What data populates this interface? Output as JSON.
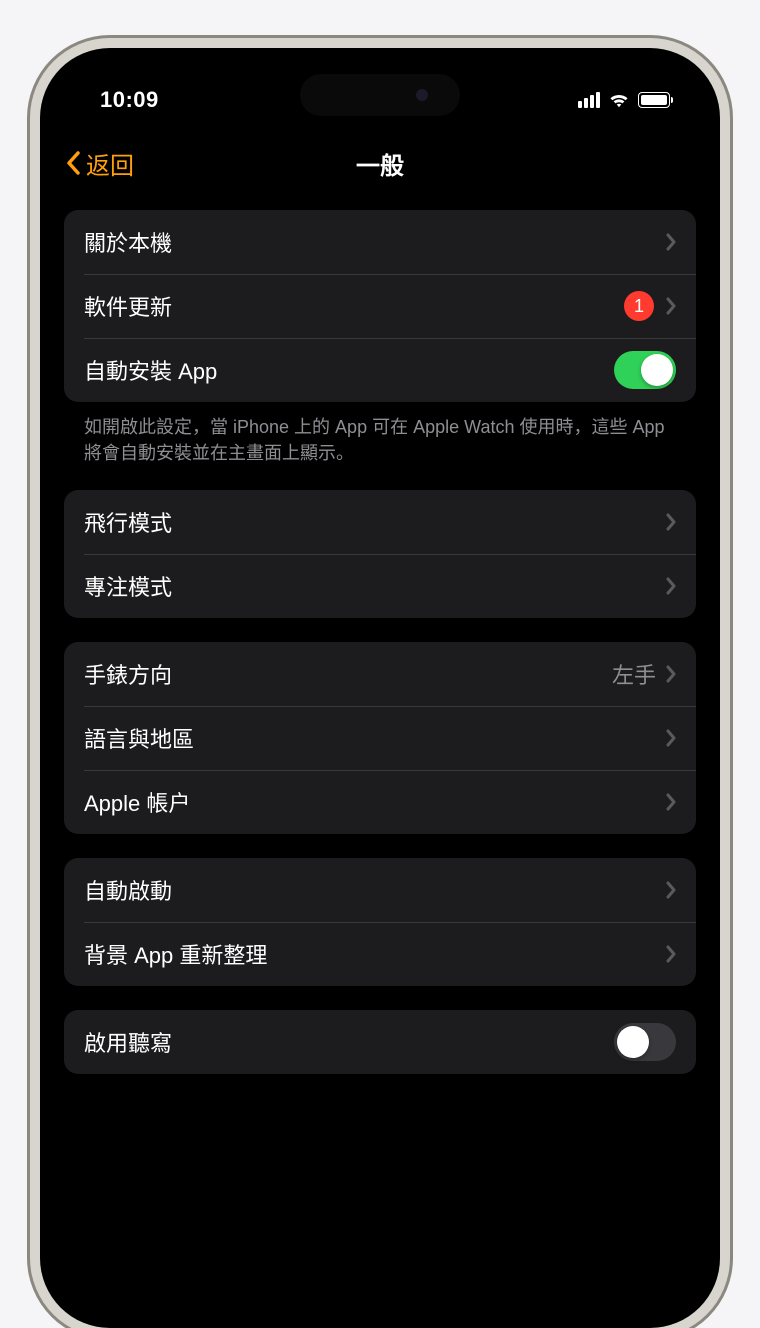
{
  "status": {
    "time": "10:09"
  },
  "nav": {
    "back": "返回",
    "title": "一般"
  },
  "group1": {
    "about": "關於本機",
    "softwareUpdate": "軟件更新",
    "badgeCount": "1",
    "autoInstall": "自動安裝 App",
    "footer": "如開啟此設定，當 iPhone 上的 App 可在 Apple Watch 使用時，這些 App 將會自動安裝並在主畫面上顯示。"
  },
  "group2": {
    "airplane": "飛行模式",
    "focus": "專注模式"
  },
  "group3": {
    "orientation": "手錶方向",
    "orientationValue": "左手",
    "language": "語言與地區",
    "appleAccount": "Apple 帳户"
  },
  "group4": {
    "autoLaunch": "自動啟動",
    "bgRefresh": "背景 App 重新整理"
  },
  "group5": {
    "dictation": "啟用聽寫"
  }
}
